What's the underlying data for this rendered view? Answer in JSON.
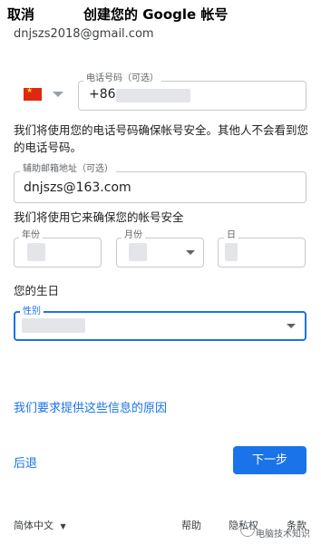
{
  "header": {
    "cancel_label": "取消",
    "title": "创建您的 Google 帐号"
  },
  "account": {
    "email_partial": "dnjszs2018@gmail.com"
  },
  "phone": {
    "label": "电话号码（可选）",
    "country": "China",
    "country_code": "+86"
  },
  "phone_note": "我们将使用您的电话号码确保帐号安全。其他人不会看到您的电话号码。",
  "recovery": {
    "label": "辅助邮箱地址（可选）",
    "value": "dnjszs@163.com"
  },
  "security_note": "我们将使用它来确保您的帐号安全",
  "birthday": {
    "year_label": "年份",
    "month_label": "月份",
    "day_label": "日",
    "caption": "您的生日"
  },
  "gender": {
    "label": "性别"
  },
  "why_link": "我们要求提供这些信息的原因",
  "actions": {
    "back_label": "后退",
    "next_label": "下一步"
  },
  "footer": {
    "language": "简体中文",
    "help": "帮助",
    "privacy": "隐私权",
    "terms": "条款",
    "watermark": "电脑技术知识"
  },
  "colors": {
    "accent": "#1a73e8",
    "text": "#202124",
    "flag_red": "#de2910"
  }
}
